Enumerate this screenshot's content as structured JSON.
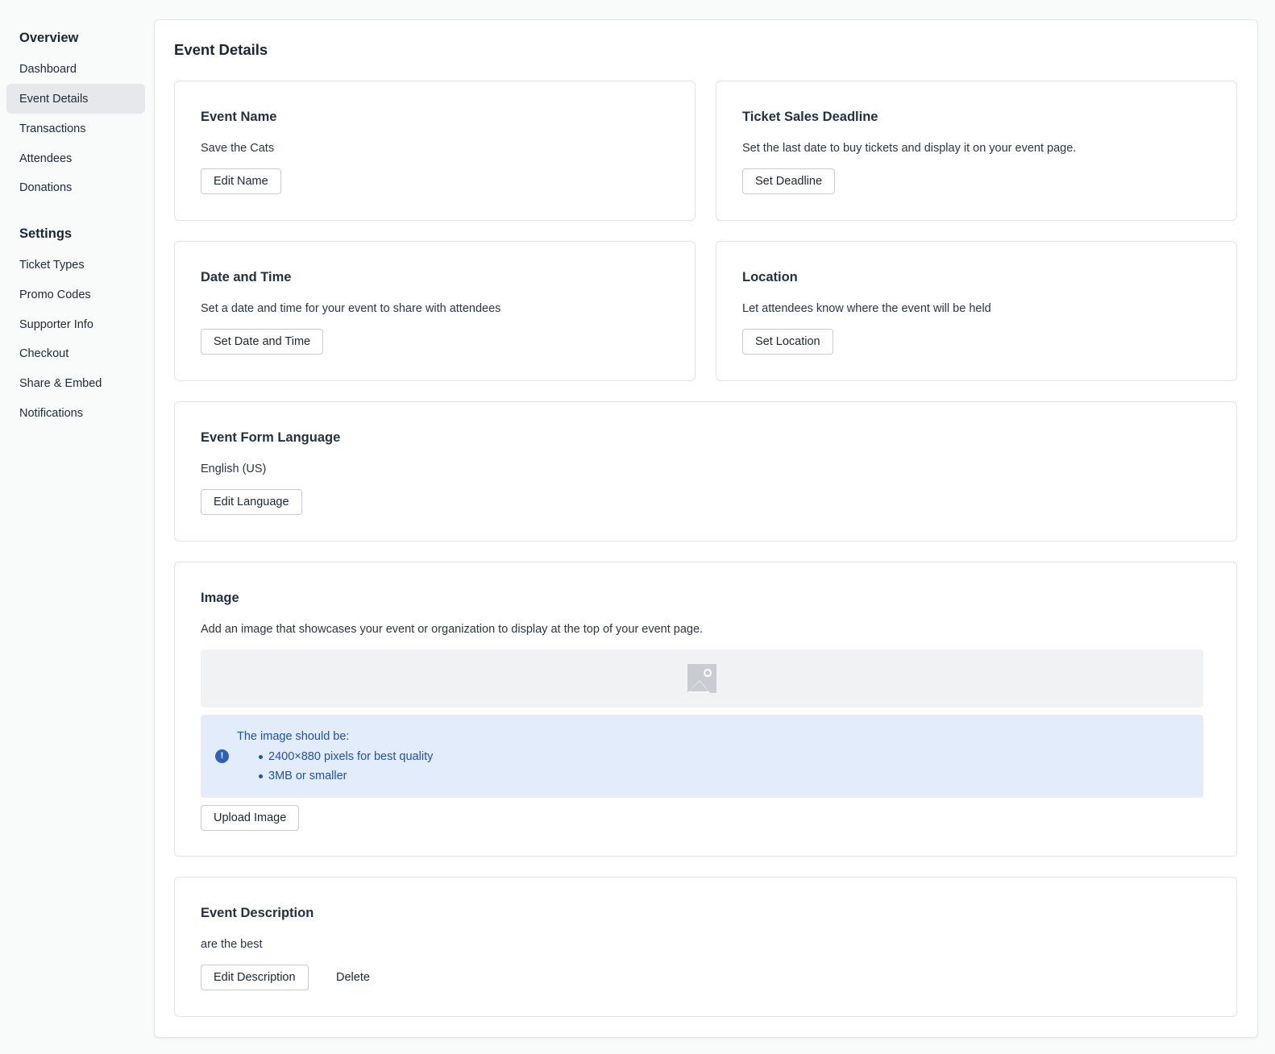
{
  "sidebar": {
    "overview_heading": "Overview",
    "overview_items": [
      {
        "label": "Dashboard"
      },
      {
        "label": "Event Details",
        "active": true
      },
      {
        "label": "Transactions"
      },
      {
        "label": "Attendees"
      },
      {
        "label": "Donations"
      }
    ],
    "settings_heading": "Settings",
    "settings_items": [
      {
        "label": "Ticket Types"
      },
      {
        "label": "Promo Codes"
      },
      {
        "label": "Supporter Info"
      },
      {
        "label": "Checkout"
      },
      {
        "label": "Share & Embed"
      },
      {
        "label": "Notifications"
      }
    ]
  },
  "main": {
    "title": "Event Details",
    "event_name": {
      "title": "Event Name",
      "value": "Save the Cats",
      "button": "Edit Name"
    },
    "deadline": {
      "title": "Ticket Sales Deadline",
      "description": "Set the last date to buy tickets and display it on your event page.",
      "button": "Set Deadline"
    },
    "date_time": {
      "title": "Date and Time",
      "description": "Set a date and time for your event to share with attendees",
      "button": "Set Date and Time"
    },
    "location": {
      "title": "Location",
      "description": "Let attendees know where the event will be held",
      "button": "Set Location"
    },
    "language": {
      "title": "Event Form Language",
      "value": "English (US)",
      "button": "Edit Language"
    },
    "image": {
      "title": "Image",
      "description": "Add an image that showcases your event or organization to display at the top of your event page.",
      "placeholder_icon": "image-placeholder-icon",
      "info_icon": "!",
      "info_heading": "The image should be:",
      "info_items": [
        "2400×880 pixels for best quality",
        "3MB or smaller"
      ],
      "button": "Upload Image"
    },
    "description": {
      "title": "Event Description",
      "value": "are the best",
      "edit_button": "Edit Description",
      "delete_button": "Delete"
    }
  },
  "colors": {
    "page_bg": "#f9fafa",
    "active_nav_bg": "#e6e8eb",
    "info_bg": "#e2ecfb",
    "info_text": "#2150a6"
  }
}
